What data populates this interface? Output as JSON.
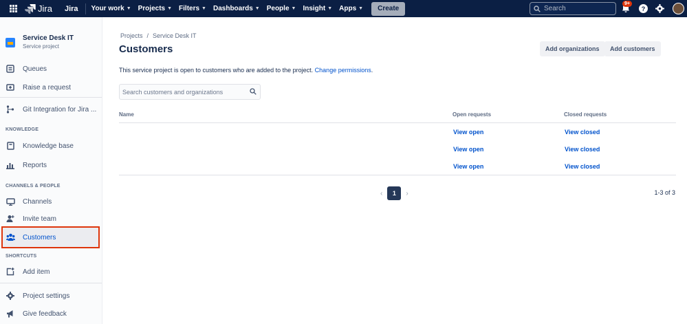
{
  "topnav": {
    "brand": "Jira",
    "product": "Jira",
    "items": [
      {
        "label": "Your work",
        "caret": true
      },
      {
        "label": "Projects",
        "caret": true
      },
      {
        "label": "Filters",
        "caret": true
      },
      {
        "label": "Dashboards",
        "caret": true
      },
      {
        "label": "People",
        "caret": true
      },
      {
        "label": "Insight",
        "caret": true
      },
      {
        "label": "Apps",
        "caret": true
      }
    ],
    "create_label": "Create",
    "search_placeholder": "Search",
    "notifications_badge": "9+"
  },
  "sidebar": {
    "project_name": "Service Desk IT",
    "project_type": "Service project",
    "items": [
      {
        "label": "Queues",
        "icon": "queues-icon"
      },
      {
        "label": "Raise a request",
        "icon": "raise-request-icon"
      },
      {
        "label": "Git Integration for Jira ...",
        "icon": "git-icon"
      },
      {
        "label": "Knowledge base",
        "icon": "knowledge-base-icon"
      },
      {
        "label": "Reports",
        "icon": "reports-icon"
      },
      {
        "label": "Channels",
        "icon": "channels-icon"
      },
      {
        "label": "Invite team",
        "icon": "invite-team-icon"
      },
      {
        "label": "Customers",
        "icon": "customers-icon"
      },
      {
        "label": "Add item",
        "icon": "add-item-icon"
      },
      {
        "label": "Project settings",
        "icon": "settings-icon"
      },
      {
        "label": "Give feedback",
        "icon": "feedback-icon"
      }
    ],
    "headings": {
      "knowledge": "KNOWLEDGE",
      "channels": "CHANNELS & PEOPLE",
      "shortcuts": "SHORTCUTS"
    },
    "active_item": "Customers"
  },
  "main": {
    "breadcrumbs": [
      "Projects",
      "Service Desk IT"
    ],
    "breadcrumb_sep": "/",
    "title": "Customers",
    "add_organizations_label": "Add organizations",
    "add_customers_label": "Add customers",
    "info_text": "This service project is open to customers who are added to the project.",
    "info_link": "Change permissions",
    "info_period": ".",
    "search_placeholder": "Search customers and organizations",
    "table": {
      "columns": [
        "Name",
        "Open requests",
        "Closed requests"
      ],
      "rows": [
        {
          "name": "",
          "open": "View open",
          "closed": "View closed"
        },
        {
          "name": "",
          "open": "View open",
          "closed": "View closed"
        },
        {
          "name": "",
          "open": "View open",
          "closed": "View closed"
        }
      ]
    },
    "pagination": {
      "current_page": "1",
      "prev": "‹",
      "next": "›"
    },
    "count_text": "1-3 of 3"
  },
  "colors": {
    "nav_bg": "#0b1f44",
    "link": "#0052cc",
    "highlight_border": "#de350b",
    "badge": "#de350b"
  }
}
